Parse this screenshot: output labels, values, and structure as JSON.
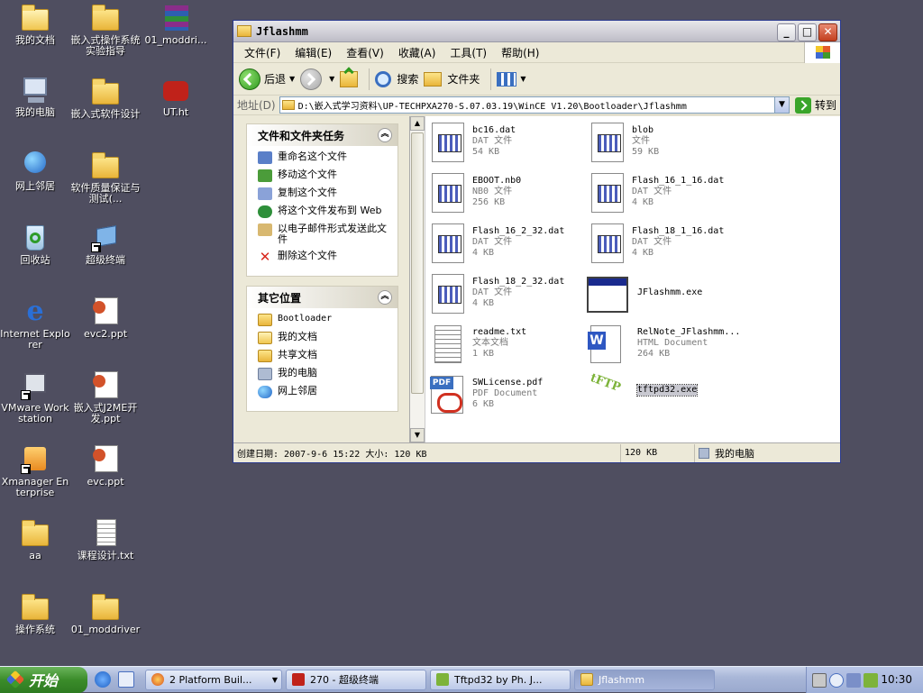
{
  "desktop": {
    "icons": [
      {
        "label": "我的文档",
        "icon": "my-documents-icon"
      },
      {
        "label": "嵌入式操作系统实验指导",
        "icon": "folder-icon"
      },
      {
        "label": "01_moddri...",
        "icon": "winrar-icon"
      },
      {
        "label": "我的电脑",
        "icon": "my-computer-icon"
      },
      {
        "label": "嵌入式软件设计",
        "icon": "folder-icon"
      },
      {
        "label": "UT.ht",
        "icon": "hyperterminal-icon"
      },
      {
        "label": "网上邻居",
        "icon": "network-icon"
      },
      {
        "label": "软件质量保证与测试(...",
        "icon": "folder-icon"
      },
      {
        "label": "回收站",
        "icon": "recycle-bin-icon"
      },
      {
        "label": "超级终端",
        "icon": "hyperterminal-shortcut-icon"
      },
      {
        "label": "Internet Explorer",
        "icon": "ie-icon"
      },
      {
        "label": "evc2.ppt",
        "icon": "ppt-icon"
      },
      {
        "label": "VMware Workstation",
        "icon": "vmware-icon"
      },
      {
        "label": "嵌入式J2ME开发.ppt",
        "icon": "ppt-icon"
      },
      {
        "label": "Xmanager Enterprise",
        "icon": "xmanager-icon"
      },
      {
        "label": "evc.ppt",
        "icon": "ppt-icon"
      },
      {
        "label": "aa",
        "icon": "folder-icon"
      },
      {
        "label": "课程设计.txt",
        "icon": "txt-icon"
      },
      {
        "label": "操作系统",
        "icon": "folder-icon"
      },
      {
        "label": "01_moddriver",
        "icon": "folder-icon"
      }
    ]
  },
  "window": {
    "title": "Jflashmm",
    "menu": [
      "文件(F)",
      "编辑(E)",
      "查看(V)",
      "收藏(A)",
      "工具(T)",
      "帮助(H)"
    ],
    "toolbar": {
      "back": "后退",
      "search": "搜索",
      "folders": "文件夹"
    },
    "address": {
      "label": "地址(D)",
      "value": "D:\\嵌入式学习资料\\UP-TECHPXA270-S.07.03.19\\WinCE V1.20\\Bootloader\\Jflashmm",
      "go": "转到"
    },
    "tasks_panel": {
      "title": "文件和文件夹任务",
      "items": [
        "重命名这个文件",
        "移动这个文件",
        "复制这个文件",
        "将这个文件发布到 Web",
        "以电子邮件形式发送此文件",
        "删除这个文件"
      ]
    },
    "places_panel": {
      "title": "其它位置",
      "items": [
        "Bootloader",
        "我的文档",
        "共享文档",
        "我的电脑",
        "网上邻居"
      ]
    },
    "files": [
      {
        "name": "bc16.dat",
        "type": "DAT 文件",
        "size": "54 KB",
        "icon": "dat-file-icon"
      },
      {
        "name": "blob",
        "type": "文件",
        "size": "59 KB",
        "icon": "dat-file-icon"
      },
      {
        "name": "EBOOT.nb0",
        "type": "NB0 文件",
        "size": "256 KB",
        "icon": "dat-file-icon"
      },
      {
        "name": "Flash_16_1_16.dat",
        "type": "DAT 文件",
        "size": "4 KB",
        "icon": "dat-file-icon"
      },
      {
        "name": "Flash_16_2_32.dat",
        "type": "DAT 文件",
        "size": "4 KB",
        "icon": "dat-file-icon"
      },
      {
        "name": "Flash_18_1_16.dat",
        "type": "DAT 文件",
        "size": "4 KB",
        "icon": "dat-file-icon"
      },
      {
        "name": "Flash_18_2_32.dat",
        "type": "DAT 文件",
        "size": "4 KB",
        "icon": "dat-file-icon"
      },
      {
        "name": "JFlashmm.exe",
        "type": "",
        "size": "",
        "icon": "exe-window-icon"
      },
      {
        "name": "readme.txt",
        "type": "文本文档",
        "size": "1 KB",
        "icon": "txt-file-icon"
      },
      {
        "name": "RelNote_JFlashmm...",
        "type": "HTML Document",
        "size": "264 KB",
        "icon": "word-doc-icon"
      },
      {
        "name": "SWLicense.pdf",
        "type": "PDF Document",
        "size": "6 KB",
        "icon": "pdf-file-icon"
      },
      {
        "name": "tftpd32.exe",
        "type": "",
        "size": "",
        "icon": "tftpd-icon",
        "selected": true
      }
    ],
    "status": {
      "info": "创建日期: 2007-9-6 15:22 大小: 120 KB",
      "size": "120 KB",
      "location": "我的电脑"
    }
  },
  "taskbar": {
    "start": "开始",
    "tasks": [
      {
        "label": "2 Platform Buil...",
        "icon": "platform-builder-icon"
      },
      {
        "label": "270 - 超级终端",
        "icon": "hyperterminal-icon"
      },
      {
        "label": "Tftpd32 by Ph. J...",
        "icon": "tftpd-icon"
      },
      {
        "label": "Jflashmm",
        "icon": "folder-icon",
        "active": true
      }
    ],
    "clock": "10:30"
  }
}
